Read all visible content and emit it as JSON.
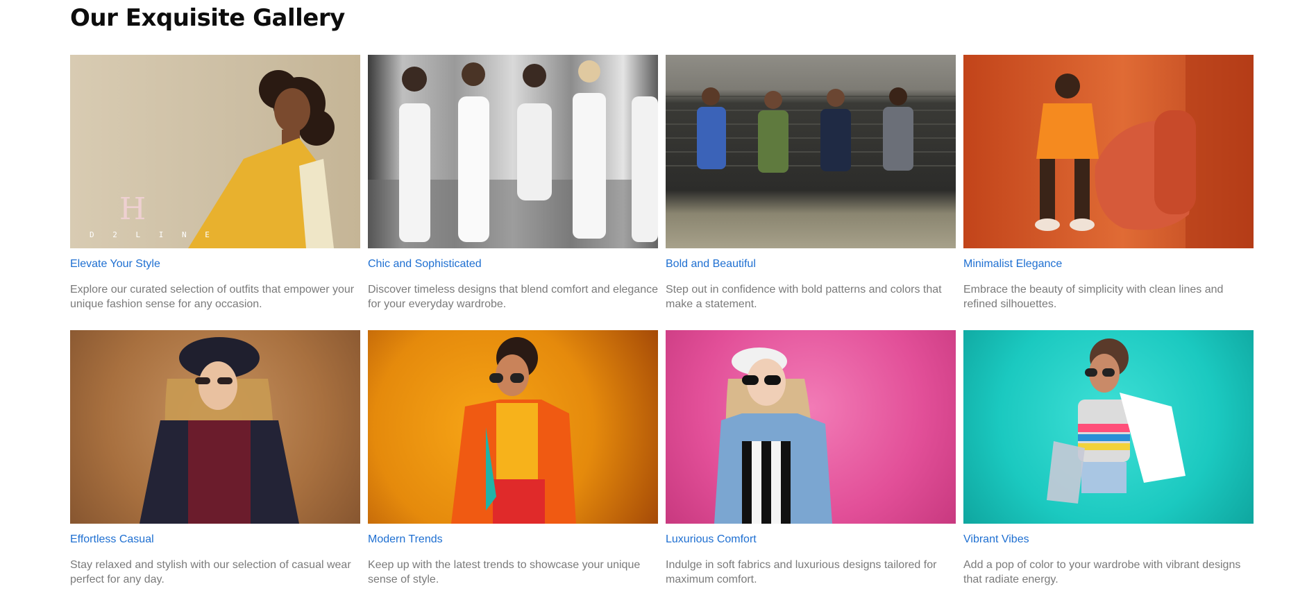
{
  "page_title": "Our Exquisite Gallery",
  "gallery": {
    "items": [
      {
        "title": "Elevate Your Style",
        "description": "Explore our curated selection of outfits that empower your unique fashion sense for any occasion.",
        "image_text": "D 2 L I N E"
      },
      {
        "title": "Chic and Sophisticated",
        "description": "Discover timeless designs that blend comfort and elegance for your everyday wardrobe."
      },
      {
        "title": "Bold and Beautiful",
        "description": "Step out in confidence with bold patterns and colors that make a statement."
      },
      {
        "title": "Minimalist Elegance",
        "description": "Embrace the beauty of simplicity with clean lines and refined silhouettes."
      },
      {
        "title": "Effortless Casual",
        "description": "Stay relaxed and stylish with our selection of casual wear perfect for any day."
      },
      {
        "title": "Modern Trends",
        "description": "Keep up with the latest trends to showcase your unique sense of style."
      },
      {
        "title": "Luxurious Comfort",
        "description": "Indulge in soft fabrics and luxurious designs tailored for maximum comfort."
      },
      {
        "title": "Vibrant Vibes",
        "description": "Add a pop of color to your wardrobe with vibrant designs that radiate energy."
      }
    ]
  }
}
